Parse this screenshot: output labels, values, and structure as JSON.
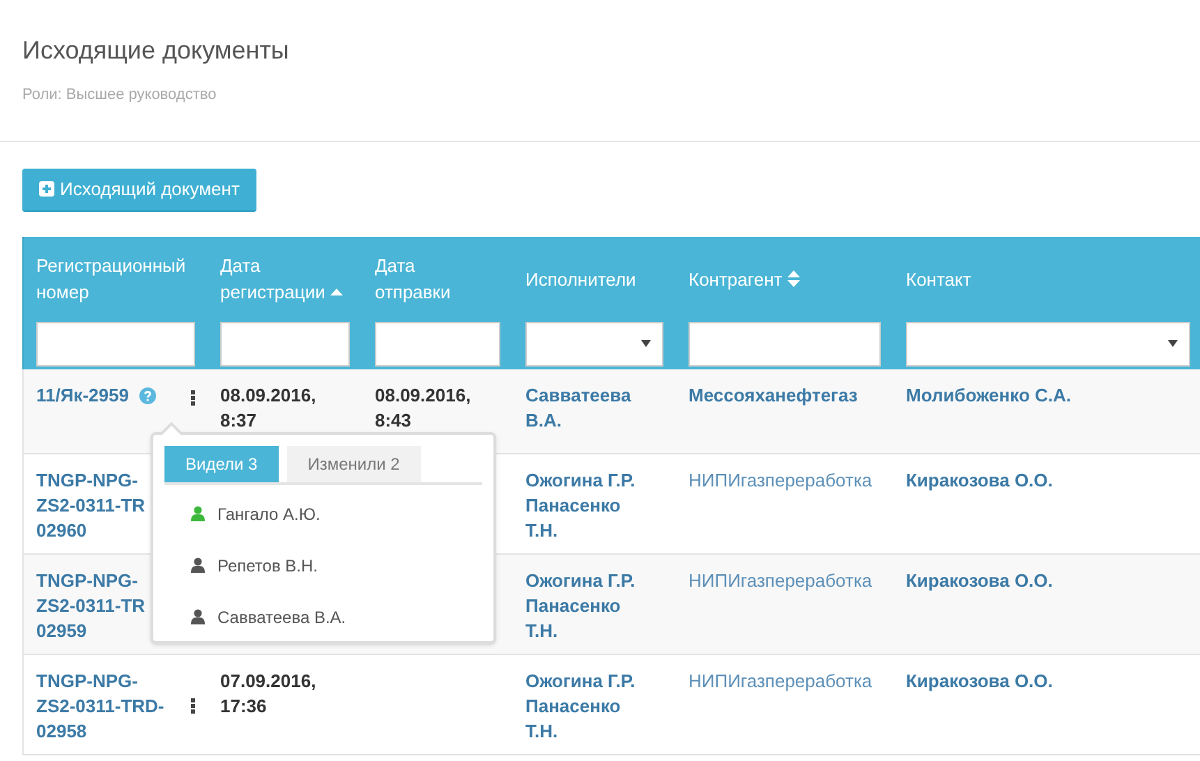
{
  "page": {
    "title": "Исходящие документы",
    "subtitle": "Роли: Высшее руководство"
  },
  "add_button": {
    "label": "Исходящий документ"
  },
  "table": {
    "columns": [
      {
        "lines": [
          "Регистрационный",
          "номер"
        ],
        "filter": {
          "kind": "text"
        }
      },
      {
        "lines": [
          "Дата",
          "регистрации"
        ],
        "sort": {
          "kind": "asc"
        },
        "filter": {
          "kind": "text"
        }
      },
      {
        "lines": [
          "Дата",
          "отправки"
        ],
        "filter": {
          "kind": "text"
        }
      },
      {
        "lines": [
          "Исполнители"
        ],
        "filter": {
          "kind": "select"
        }
      },
      {
        "lines": [
          "Контрагент"
        ],
        "sort": {
          "kind": "both"
        },
        "filter": {
          "kind": "text"
        }
      },
      {
        "lines": [
          "Контакт"
        ],
        "filter": {
          "kind": "select"
        }
      }
    ],
    "rows": [
      {
        "reg": [
          "11/Як-2959"
        ],
        "help": true,
        "menu": true,
        "date_reg": [
          "08.09.2016,",
          "8:37"
        ],
        "date_sent": [
          "08.09.2016,",
          "8:43"
        ],
        "executors": [
          "Савватеева",
          "В.А."
        ],
        "contractor": {
          "text": "Мессояханефтегаз",
          "emphasis": true
        },
        "contact": "Молибоженко С.А."
      },
      {
        "reg": [
          "TNGP-NPG-",
          "ZS2-0311-TR",
          "02960"
        ],
        "help": false,
        "menu": false,
        "date_reg": [],
        "date_sent": [],
        "executors": [
          "Ожогина Г.Р.",
          "Панасенко",
          "Т.Н."
        ],
        "contractor": {
          "text": "НИПИгазпереработка",
          "emphasis": false
        },
        "contact": "Киракозова О.О."
      },
      {
        "reg": [
          "TNGP-NPG-",
          "ZS2-0311-TR",
          "02959"
        ],
        "help": false,
        "menu": false,
        "date_reg": [],
        "date_sent": [],
        "executors": [
          "Ожогина Г.Р.",
          "Панасенко",
          "Т.Н."
        ],
        "contractor": {
          "text": "НИПИгазпереработка",
          "emphasis": false
        },
        "contact": "Киракозова О.О."
      },
      {
        "reg": [
          "TNGP-NPG-",
          "ZS2-0311-TRD-",
          "02958"
        ],
        "help": false,
        "menu": true,
        "date_reg": [
          "07.09.2016,",
          "17:36"
        ],
        "date_sent": [],
        "executors": [
          "Ожогина Г.Р.",
          "Панасенко",
          "Т.Н."
        ],
        "contractor": {
          "text": "НИПИгазпереработка",
          "emphasis": false
        },
        "contact": "Киракозова О.О."
      }
    ]
  },
  "popover": {
    "tabs": [
      {
        "label": "Видели 3",
        "selected": true
      },
      {
        "label": "Изменили 2",
        "selected": false
      }
    ],
    "users": [
      {
        "name": "Гангало А.Ю.",
        "online": true
      },
      {
        "name": "Репетов В.Н.",
        "online": false
      },
      {
        "name": "Савватеева В.А.",
        "online": false
      }
    ]
  }
}
